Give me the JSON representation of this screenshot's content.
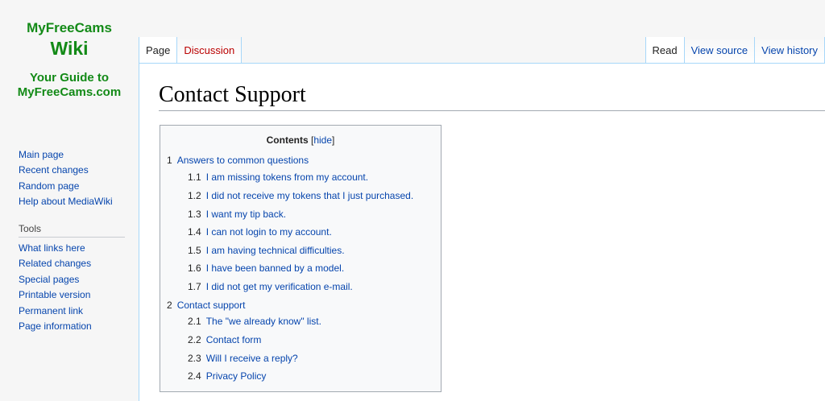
{
  "logo": {
    "line1": "MyFreeCams",
    "line2": "Wiki",
    "line3": "Your Guide to",
    "line4": "MyFreeCams.com"
  },
  "sidebar": {
    "navigation": [
      "Main page",
      "Recent changes",
      "Random page",
      "Help about MediaWiki"
    ],
    "tools_heading": "Tools",
    "tools": [
      "What links here",
      "Related changes",
      "Special pages",
      "Printable version",
      "Permanent link",
      "Page information"
    ]
  },
  "tabs": {
    "left": [
      {
        "label": "Page",
        "selected": true
      },
      {
        "label": "Discussion",
        "selected": false
      }
    ],
    "right": [
      {
        "label": "Read",
        "selected": true
      },
      {
        "label": "View source",
        "selected": false
      },
      {
        "label": "View history",
        "selected": false
      }
    ]
  },
  "page": {
    "title": "Contact Support"
  },
  "toc": {
    "title": "Contents",
    "hide_label": "hide",
    "items": [
      {
        "num": "1",
        "text": "Answers to common questions",
        "level": 1
      },
      {
        "num": "1.1",
        "text": "I am missing tokens from my account.",
        "level": 2
      },
      {
        "num": "1.2",
        "text": "I did not receive my tokens that I just purchased.",
        "level": 2
      },
      {
        "num": "1.3",
        "text": "I want my tip back.",
        "level": 2
      },
      {
        "num": "1.4",
        "text": "I can not login to my account.",
        "level": 2
      },
      {
        "num": "1.5",
        "text": "I am having technical difficulties.",
        "level": 2
      },
      {
        "num": "1.6",
        "text": "I have been banned by a model.",
        "level": 2
      },
      {
        "num": "1.7",
        "text": "I did not get my verification e-mail.",
        "level": 2
      },
      {
        "num": "2",
        "text": "Contact support",
        "level": 1
      },
      {
        "num": "2.1",
        "text": "The \"we already know\" list.",
        "level": 2
      },
      {
        "num": "2.2",
        "text": "Contact form",
        "level": 2
      },
      {
        "num": "2.3",
        "text": "Will I receive a reply?",
        "level": 2
      },
      {
        "num": "2.4",
        "text": "Privacy Policy",
        "level": 2
      }
    ]
  },
  "colors": {
    "logo": "#138a17",
    "link": "#0645ad",
    "new_link": "#ba0000",
    "tab_border": "#a7d7f9"
  }
}
